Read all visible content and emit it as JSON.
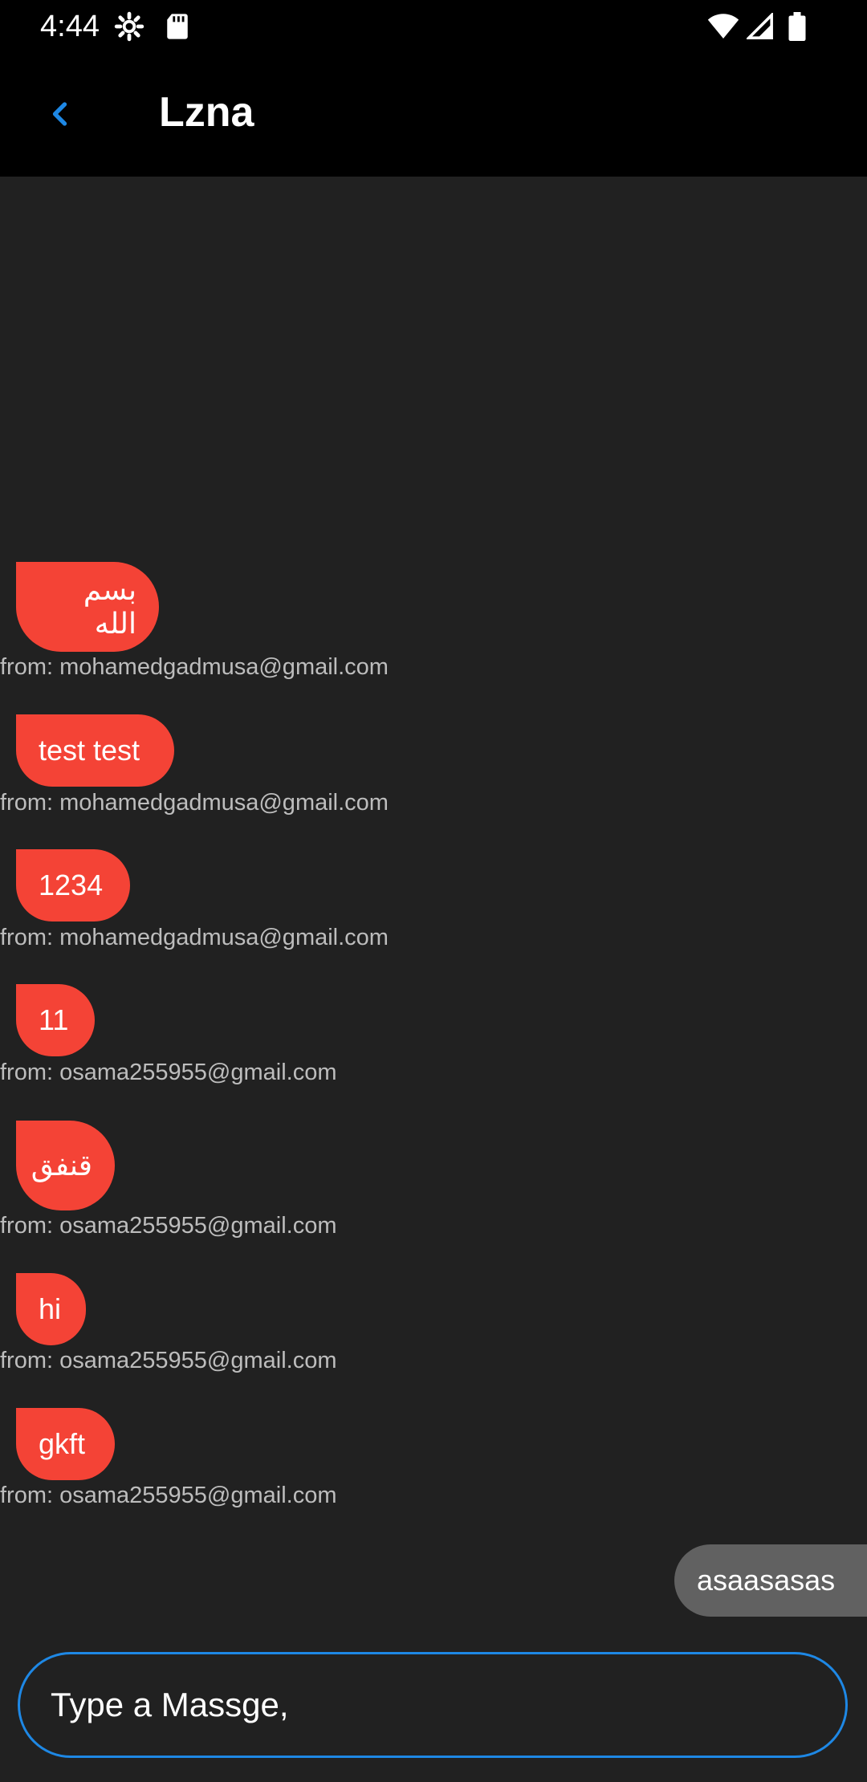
{
  "status_bar": {
    "time": "4:44",
    "icons": [
      "settings-gear-icon",
      "sd-card-icon",
      "wifi-icon",
      "cell-signal-icon",
      "battery-icon"
    ]
  },
  "app_bar": {
    "back_icon": "chevron-left-icon",
    "title": "Lzna",
    "accent_color": "#1e88e5"
  },
  "messages": [
    {
      "text": "بسم الله",
      "sender": "from: mohamedgadmusa@gmail.com"
    },
    {
      "text": "test test",
      "sender": "from: mohamedgadmusa@gmail.com"
    },
    {
      "text": "1234",
      "sender": "from: mohamedgadmusa@gmail.com"
    },
    {
      "text": "11",
      "sender": "from: osama255955@gmail.com"
    },
    {
      "text": "قنفق",
      "sender": "from: osama255955@gmail.com"
    },
    {
      "text": "hi",
      "sender": "from: osama255955@gmail.com"
    },
    {
      "text": "gkft",
      "sender": "from: osama255955@gmail.com"
    }
  ],
  "sent_message": {
    "text": "asaasasas"
  },
  "composer": {
    "placeholder": "Type a Massge,"
  },
  "colors": {
    "received_bubble": "#f44336",
    "sent_bubble": "#616161",
    "background": "#212121",
    "bar": "#000000"
  }
}
